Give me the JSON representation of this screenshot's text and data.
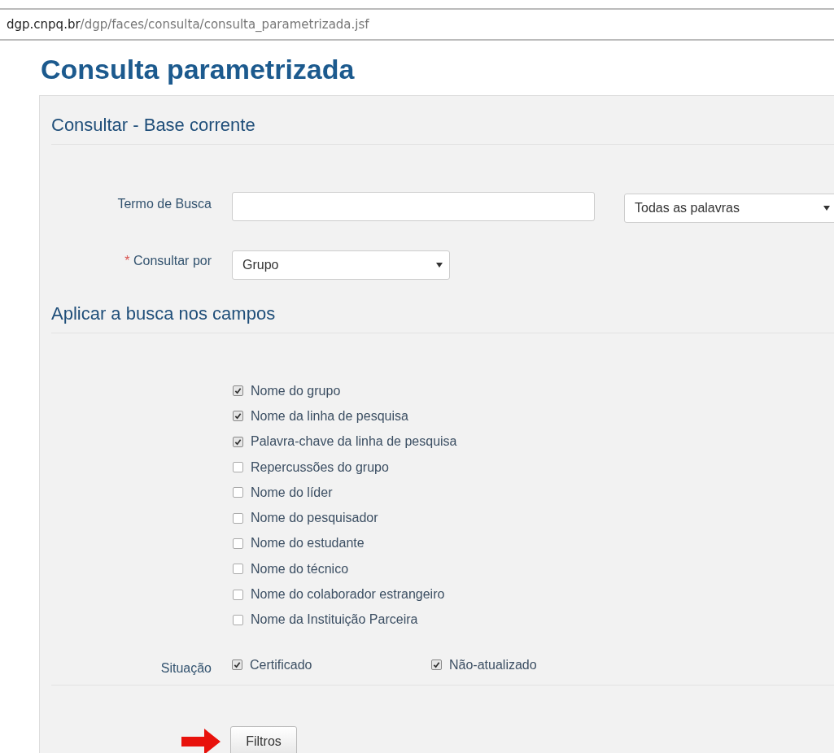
{
  "address_bar": {
    "host": "dgp.cnpq.br",
    "path": "/dgp/faces/consulta/consulta_parametrizada.jsf"
  },
  "page_title": "Consulta parametrizada",
  "section_search": {
    "heading": "Consultar - Base corrente",
    "term": {
      "label": "Termo de Busca",
      "mode": "Todas as palavras"
    },
    "search_by": {
      "required_mark": "*",
      "label": "Consultar por",
      "value": "Grupo"
    }
  },
  "section_fields": {
    "heading": "Aplicar a busca nos campos",
    "fields": [
      {
        "label": "Nome do grupo",
        "checked": true
      },
      {
        "label": "Nome da linha de pesquisa",
        "checked": true
      },
      {
        "label": "Palavra-chave da linha de pesquisa",
        "checked": true
      },
      {
        "label": "Repercussões do grupo",
        "checked": false
      },
      {
        "label": "Nome do líder",
        "checked": false
      },
      {
        "label": "Nome do pesquisador",
        "checked": false
      },
      {
        "label": "Nome do estudante",
        "checked": false
      },
      {
        "label": "Nome do técnico",
        "checked": false
      },
      {
        "label": "Nome do colaborador estrangeiro",
        "checked": false
      },
      {
        "label": "Nome da Instituição Parceira",
        "checked": false
      }
    ],
    "status": {
      "label": "Situação",
      "options": [
        {
          "label": "Certificado",
          "checked": true
        },
        {
          "label": "Não-atualizado",
          "checked": true
        }
      ]
    }
  },
  "filters_button": "Filtros"
}
